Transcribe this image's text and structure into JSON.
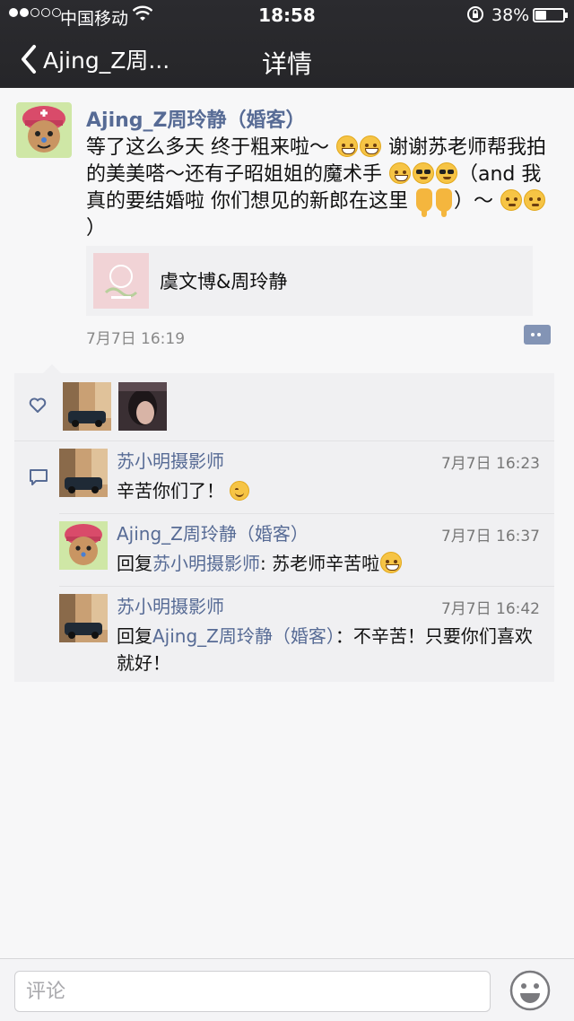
{
  "status_bar": {
    "carrier": "中国移动",
    "time": "18:58",
    "battery_percent": "38%",
    "battery_level": 0.38,
    "signal_bars": 2,
    "icons": [
      "signal-icon",
      "wifi-icon",
      "rotation-lock-icon",
      "battery-icon"
    ]
  },
  "nav": {
    "back_label": "Ajing_Z周...",
    "title": "详情"
  },
  "post": {
    "author": "Ajing_Z周玲静（婚客）",
    "text_segments": {
      "s1": "等了这么多天 终于粗来啦～ ",
      "s2": " 谢谢苏老师帮我拍的美美嗒～还有子昭姐姐的魔术手 ",
      "s3": "（and 我真的要结婚啦 你们想见的新郎在这里 ",
      "s4": "）～ ",
      "s5": "）"
    },
    "link_card": {
      "title": "虞文博&周玲静"
    },
    "time": "7月7日 16:19"
  },
  "likes": {
    "icon": "heart-icon"
  },
  "comments": [
    {
      "author": "苏小明摄影师",
      "time": "7月7日 16:23",
      "text": "辛苦你们了！"
    },
    {
      "author": "Ajing_Z周玲静（婚客）",
      "time": "7月7日 16:37",
      "reply_prefix": "回复",
      "reply_to": "苏小明摄影师",
      "text": ": 苏老师辛苦啦"
    },
    {
      "author": "苏小明摄影师",
      "time": "7月7日 16:42",
      "reply_prefix": "回复",
      "reply_to": "Ajing_Z周玲静（婚客）",
      "text": "：不辛苦！只要你们喜欢就好！"
    }
  ],
  "input_bar": {
    "placeholder": "评论",
    "emoji_icon": "emoji-face-icon"
  },
  "colors": {
    "nav_bg": "#262629",
    "link_blue": "#576b95",
    "page_bg": "#f7f7f8",
    "box_bg": "#f0f0f2"
  }
}
